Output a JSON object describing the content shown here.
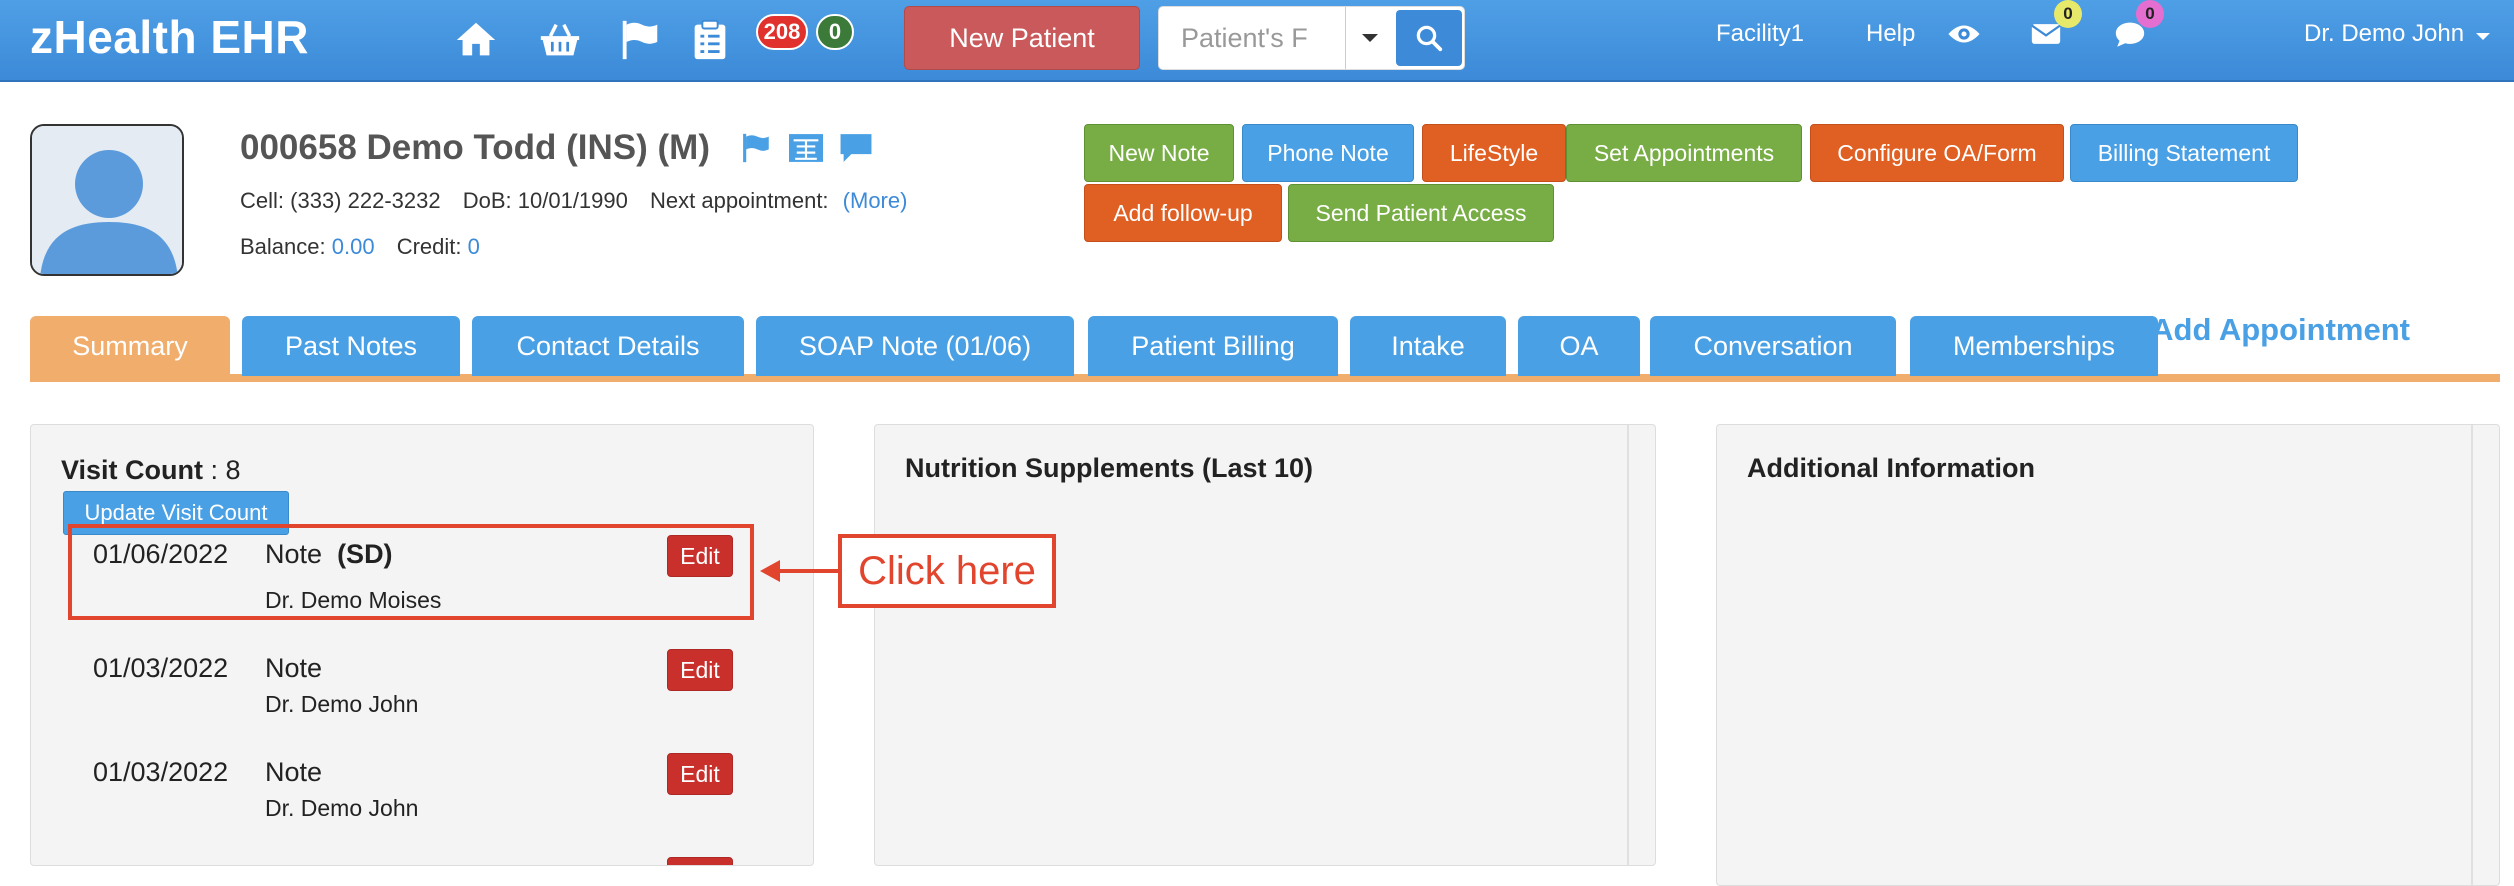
{
  "app": {
    "brand": "zHealth EHR"
  },
  "nav": {
    "icons": [
      "home-icon",
      "basket-icon",
      "flag-icon",
      "clipboard-icon"
    ],
    "badge_red": "208",
    "badge_green": "0",
    "new_patient": "New Patient",
    "search_placeholder": "Patient's F",
    "facility": "Facility1",
    "help": "Help",
    "mail_count": "0",
    "chat_count": "0",
    "user": "Dr. Demo John"
  },
  "patient": {
    "name": "000658 Demo Todd  (INS) (M)",
    "cell_label": "Cell:",
    "cell": "(333) 222-3232",
    "dob_label": "DoB:",
    "dob": "10/01/1990",
    "next_label": "Next appointment:",
    "next_link": "(More)",
    "balance_label": "Balance:",
    "balance": "0.00",
    "credit_label": "Credit:",
    "credit": "0"
  },
  "actions": {
    "new_note": "New Note",
    "phone_note": "Phone Note",
    "lifestyle": "LifeStyle",
    "set_appointments": "Set Appointments",
    "configure": "Configure OA/Form",
    "billing_statement": "Billing Statement",
    "add_followup": "Add follow-up",
    "send_access": "Send Patient Access"
  },
  "tabs": {
    "summary": "Summary",
    "past_notes": "Past Notes",
    "contact": "Contact Details",
    "soap": "SOAP Note (01/06)",
    "billing": "Patient Billing",
    "intake": "Intake",
    "oa": "OA",
    "conversation": "Conversation",
    "memberships": "Memberships",
    "add_appointment": "Add Appointment"
  },
  "visits": {
    "label": "Visit Count",
    "count": ": 8",
    "update_btn": "Update Visit Count",
    "edit_label": "Edit",
    "items": [
      {
        "date": "01/06/2022",
        "type": "Note",
        "tag": "(SD)",
        "doctor": "Dr. Demo Moises"
      },
      {
        "date": "01/03/2022",
        "type": "Note",
        "tag": "",
        "doctor": "Dr. Demo John"
      },
      {
        "date": "01/03/2022",
        "type": "Note",
        "tag": "",
        "doctor": "Dr. Demo John"
      }
    ]
  },
  "panels": {
    "nutrition": "Nutrition Supplements (Last 10)",
    "additional": "Additional Information"
  },
  "annotation": {
    "callout": "Click here",
    "color": "#e2452e"
  },
  "colors": {
    "topbar": "#3c8ad8",
    "tab_blue": "#4aa0e4",
    "tab_active": "#f0ad6c",
    "green": "#77ad44",
    "orange": "#e05f22",
    "edit_red": "#c9302c",
    "new_patient": "#c9595a"
  }
}
